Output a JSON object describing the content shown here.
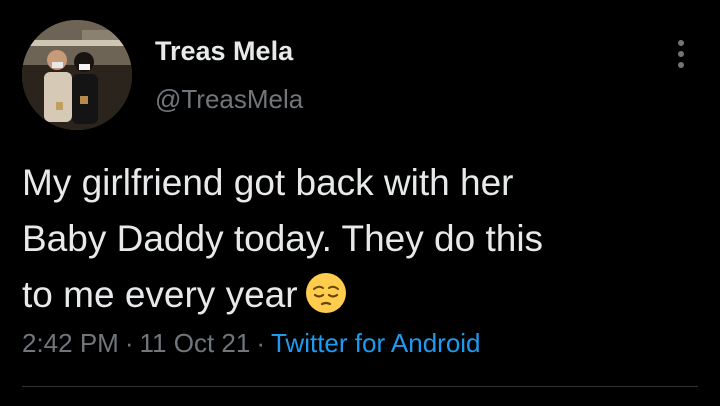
{
  "author": {
    "name": "Treas Mela",
    "handle": "@TreasMela",
    "avatar_icon": "profile-photo"
  },
  "tweet": {
    "lines": [
      "My girlfriend got back with her",
      "Baby Daddy today. They do this",
      "to me every year"
    ],
    "emoji": "pensive-face-emoji"
  },
  "meta": {
    "time": "2:42 PM",
    "separator": "·",
    "date": "11 Oct 21",
    "source": "Twitter for Android"
  },
  "menu": {
    "icon": "more-options-icon"
  },
  "colors": {
    "background": "#000000",
    "text": "#e7e9ea",
    "secondary": "#71767b",
    "link": "#1d9bf0",
    "divider": "#2f3336"
  }
}
